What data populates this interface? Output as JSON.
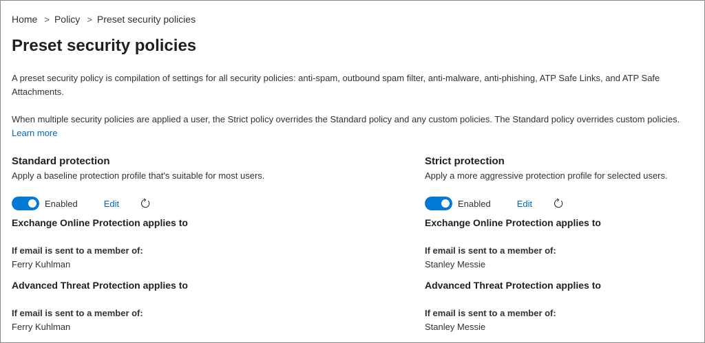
{
  "breadcrumb": {
    "items": [
      "Home",
      "Policy"
    ],
    "separator": ">",
    "current": "Preset security policies"
  },
  "page": {
    "title": "Preset security policies",
    "description_1": "A preset security policy is compilation of settings for all security policies: anti-spam, outbound spam filter, anti-malware, anti-phishing, ATP Safe Links, and ATP Safe Attachments.",
    "description_2": "When multiple security policies are applied a user, the Strict policy overrides the Standard policy and any custom policies. The Standard policy overrides custom policies.",
    "learn_more": "Learn more"
  },
  "standard": {
    "title": "Standard protection",
    "subtitle": "Apply a baseline protection profile that's suitable for most users.",
    "toggle_state": "Enabled",
    "edit_label": "Edit",
    "eop_title": "Exchange Online Protection applies to",
    "eop_condition": "If email is sent to a member of:",
    "eop_value": "Ferry Kuhlman",
    "atp_title": "Advanced Threat Protection applies to",
    "atp_condition": "If email is sent to a member of:",
    "atp_value": "Ferry Kuhlman"
  },
  "strict": {
    "title": "Strict protection",
    "subtitle": "Apply a more aggressive protection profile for selected users.",
    "toggle_state": "Enabled",
    "edit_label": "Edit",
    "eop_title": "Exchange Online Protection applies to",
    "eop_condition": "If email is sent to a member of:",
    "eop_value": "Stanley Messie",
    "atp_title": "Advanced Threat Protection applies to",
    "atp_condition": "If email is sent to a member of:",
    "atp_value": "Stanley Messie"
  },
  "colors": {
    "accent": "#0078d4",
    "link": "#0066b3",
    "text": "#323130"
  },
  "icons": {
    "refresh": "refresh-icon"
  }
}
